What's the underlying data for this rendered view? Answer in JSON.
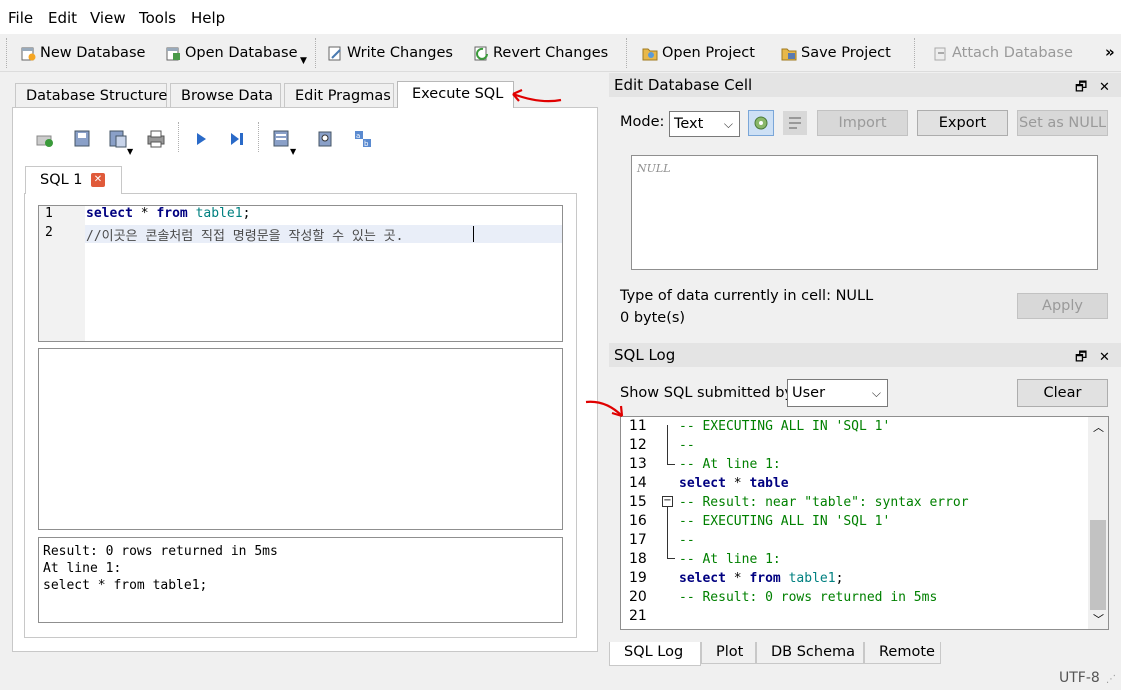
{
  "menu": [
    "File",
    "Edit",
    "View",
    "Tools",
    "Help"
  ],
  "toolbar": {
    "new_db": "New Database",
    "open_db": "Open Database",
    "write": "Write Changes",
    "revert": "Revert Changes",
    "open_project": "Open Project",
    "save_project": "Save Project",
    "attach": "Attach Database",
    "overflow": "»"
  },
  "tabs": [
    "Database Structure",
    "Browse Data",
    "Edit Pragmas",
    "Execute SQL"
  ],
  "sql_tab": {
    "label": "SQL 1",
    "close": "✕"
  },
  "editor": {
    "line_numbers": [
      "1",
      "2"
    ],
    "line1": {
      "kw1": "select",
      "op": " * ",
      "kw2": "from",
      "table": " table1",
      "end": ";"
    },
    "line2": "//이곳은 콘솔처럼 직접 명령문을 작성할 수 있는 곳."
  },
  "result_message": "Result: 0 rows returned in 5ms\nAt line 1:\nselect * from table1;",
  "edit_cell": {
    "title": "Edit Database Cell",
    "mode_label": "Mode:",
    "mode_value": "Text",
    "import": "Import",
    "export": "Export",
    "set_null": "Set as NULL",
    "null_placeholder": "NULL",
    "type_info": "Type of data currently in cell: NULL",
    "size_info": "0 byte(s)",
    "apply": "Apply"
  },
  "sql_log": {
    "title": "SQL Log",
    "show_label": "Show SQL submitted by",
    "submitted_by": "User",
    "clear": "Clear",
    "lines": [
      {
        "n": "11",
        "text": "-- EXECUTING ALL IN 'SQL 1'"
      },
      {
        "n": "12",
        "text": "--"
      },
      {
        "n": "13",
        "text": "-- At line 1:"
      },
      {
        "n": "14",
        "text": "select * table"
      },
      {
        "n": "15",
        "text": "-- Result: near \"table\": syntax error"
      },
      {
        "n": "16",
        "text": "-- EXECUTING ALL IN 'SQL 1'"
      },
      {
        "n": "17",
        "text": "--"
      },
      {
        "n": "18",
        "text": "-- At line 1:"
      },
      {
        "n": "19",
        "text": "select * from table1;"
      },
      {
        "n": "20",
        "text": "-- Result: 0 rows returned in 5ms"
      },
      {
        "n": "21",
        "text": ""
      }
    ]
  },
  "bottom_tabs": [
    "SQL Log",
    "Plot",
    "DB Schema",
    "Remote"
  ],
  "status": {
    "encoding": "UTF-8"
  },
  "colors": {
    "keyword": "#000080",
    "table": "#008080",
    "comment": "#008000",
    "annotation": "#e00000"
  }
}
